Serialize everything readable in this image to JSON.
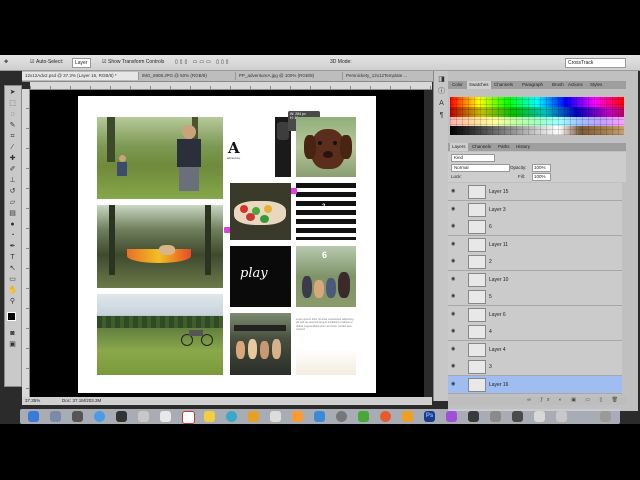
{
  "options_bar": {
    "auto_select_label": "Auto-Select:",
    "auto_select_value": "Layer",
    "transform_label": "Show Transform Controls",
    "mode_label": "3D Mode:",
    "workspace": "CrossTrack"
  },
  "tabs": [
    {
      "label": "12x12Adv2.psd @ 37.3% (Layer 16, RGB/8) *",
      "active": true
    },
    {
      "label": "IMG_6908.JPG @ 50% (RGB/8)",
      "active": false
    },
    {
      "label": "PP_adventureA.jpg @ 100% (RGB/8)",
      "active": false
    },
    {
      "label": "Persnickety_12x12Template ...",
      "active": false
    }
  ],
  "status": {
    "zoom": "37.35%",
    "doc": "Doc: 37.1M/203.3M"
  },
  "tooltip": {
    "w": "W: 284 px",
    "h": "H: 40 px"
  },
  "document": {
    "title_letter": "A",
    "title_sub": "adventure",
    "play_word": "play",
    "number": "6",
    "journal_text": "Lorem ipsum dolor sit amet consectetur adipiscing elit sed do eiusmod tempor incididunt ut labore et dolore magna aliqua enim ad minim veniam quis nostrud"
  },
  "panel": {
    "top_tabs": [
      "Color",
      "Swatches",
      "Channels",
      "Paragraph",
      "Brush",
      "Actions",
      "Styles"
    ],
    "active_top_tab": "Swatches",
    "layer_tabs": [
      "Layers",
      "Channels",
      "Paths",
      "History"
    ],
    "filter_kind": "Kind",
    "blend_mode": "Normal",
    "opacity_label": "Opacity:",
    "opacity": "100%",
    "lock_label": "Lock:",
    "fill_label": "Fill:",
    "fill": "100%",
    "layers": [
      {
        "name": "Layer 15",
        "selected": false
      },
      {
        "name": "Layer 3",
        "selected": false
      },
      {
        "name": "6",
        "selected": false
      },
      {
        "name": "Layer 11",
        "selected": false
      },
      {
        "name": "2",
        "selected": false
      },
      {
        "name": "Layer 10",
        "selected": false
      },
      {
        "name": "5",
        "selected": false
      },
      {
        "name": "Layer 6",
        "selected": false
      },
      {
        "name": "4",
        "selected": false
      },
      {
        "name": "Layer 4",
        "selected": false
      },
      {
        "name": "3",
        "selected": false
      },
      {
        "name": "Layer 16",
        "selected": true
      }
    ]
  },
  "colors": {
    "accent_pink": "#e040e0",
    "selection_blue": "#9fbdf0",
    "ps_blue": "#1e3a8a"
  }
}
